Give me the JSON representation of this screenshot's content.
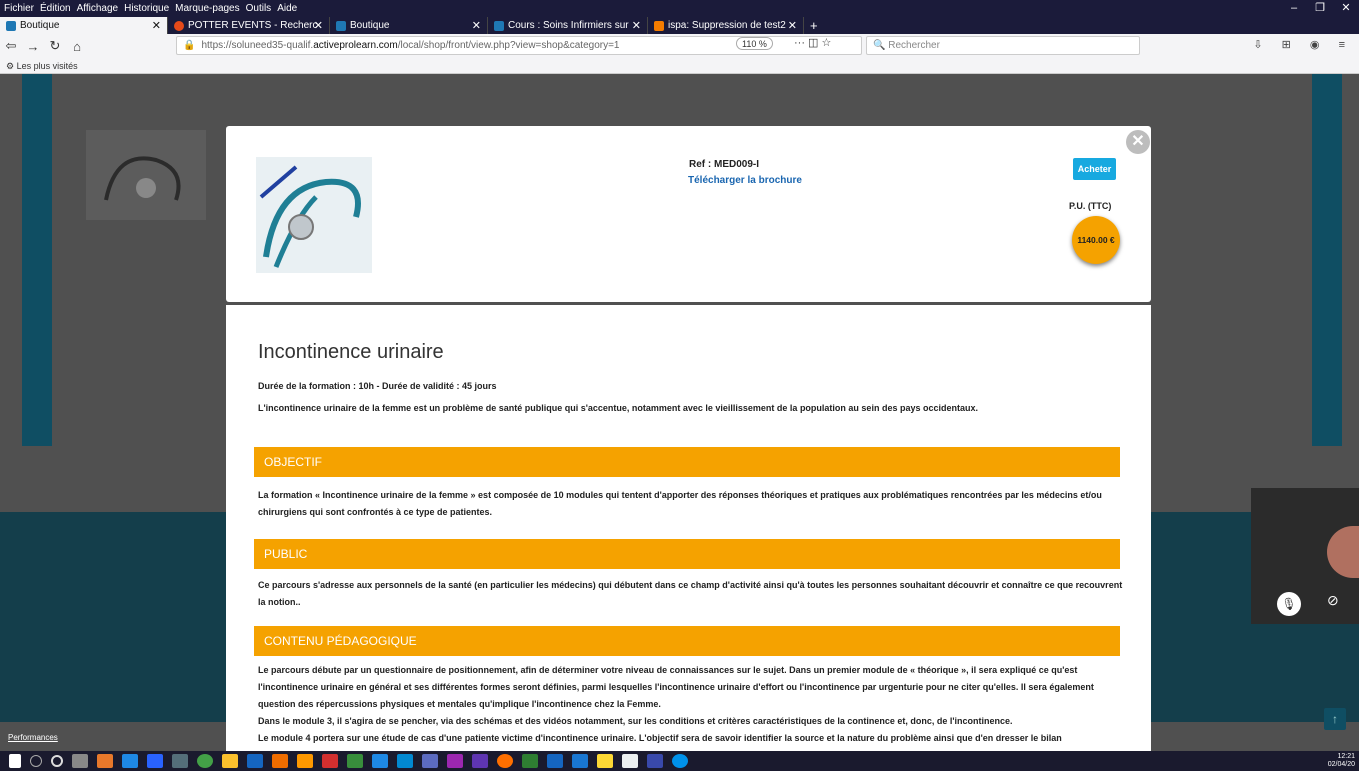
{
  "menu": [
    "Fichier",
    "Édition",
    "Affichage",
    "Historique",
    "Marque-pages",
    "Outils",
    "Aide"
  ],
  "window_controls": {
    "min": "–",
    "max": "❐",
    "close": "✕"
  },
  "tabs": [
    {
      "label": "Boutique",
      "color": "#1f78b4"
    },
    {
      "label": "POTTER EVENTS - Recherc",
      "color": "#e64a19"
    },
    {
      "label": "Boutique",
      "color": "#1f78b4"
    },
    {
      "label": "Cours : Soins Infirmiers sur",
      "color": "#1f78b4"
    },
    {
      "label": "ispa: Suppression de test2",
      "color": "#f57c00"
    }
  ],
  "nav": {
    "url_prefix": "https://soluneed35-qualif.",
    "url_domain": "activeprolearn.com",
    "url_suffix": "/local/shop/front/view.php?view=shop&category=1",
    "zoom": "110 %",
    "search_placeholder": "Rechercher"
  },
  "bookmarks": {
    "label": "Les plus visités"
  },
  "product": {
    "ref": "Ref : MED009-I",
    "brochure": "Télécharger la brochure",
    "buy_label": "Acheter",
    "pu_label": "P.U. (TTC)",
    "price": "1140.00 €"
  },
  "course": {
    "title": "Incontinence urinaire",
    "duration": "Durée de la formation : 10h - Durée de validité : 45 jours",
    "intro": "L'incontinence urinaire de la femme est un problème de santé publique qui s'accentue, notamment avec le vieillissement de la population au sein des pays occidentaux.",
    "sections": [
      {
        "heading": "OBJECTIF",
        "text": "La formation « Incontinence urinaire de la femme » est composée de 10 modules qui tentent d'apporter des réponses théoriques et pratiques aux problématiques rencontrées par les médecins et/ou chirurgiens qui sont confrontés à ce type de patientes."
      },
      {
        "heading": "PUBLIC",
        "text": "Ce parcours s'adresse aux personnels de la santé (en particulier les médecins) qui débutent dans ce champ d'activité ainsi qu'à toutes les personnes souhaitant découvrir et connaître ce que recouvrent la notion.."
      },
      {
        "heading": "CONTENU PÉDAGOGIQUE",
        "text": "Le parcours débute par un questionnaire de positionnement, afin de déterminer votre niveau de connaissances sur le sujet. Dans un premier module de « théorique », il sera expliqué ce qu'est l'incontinence urinaire en général et ses différentes formes seront définies, parmi lesquelles l'incontinence urinaire d'effort ou l'incontinence par urgenturie pour ne citer qu'elles. Il sera également question des répercussions physiques et mentales qu'implique l'incontinence chez la Femme.\nDans le module 3, il s'agira de se pencher, via des schémas et des vidéos notamment, sur les conditions et critères caractéristiques de la continence et, donc, de l'incontinence.\nLe module 4 portera sur une étude de cas d'une patiente victime d'incontinence urinaire. L'objectif sera de savoir identifier la source et la nature du problème ainsi que d'en dresser le bilan urodynamique."
      }
    ]
  },
  "footer": {
    "performance": "Performances"
  },
  "tray": {
    "time": "12:21",
    "date": "02/04/20"
  },
  "colors": {
    "accent_orange": "#f5a200",
    "buy_blue": "#17a9e0",
    "teal": "#0f4e63"
  }
}
